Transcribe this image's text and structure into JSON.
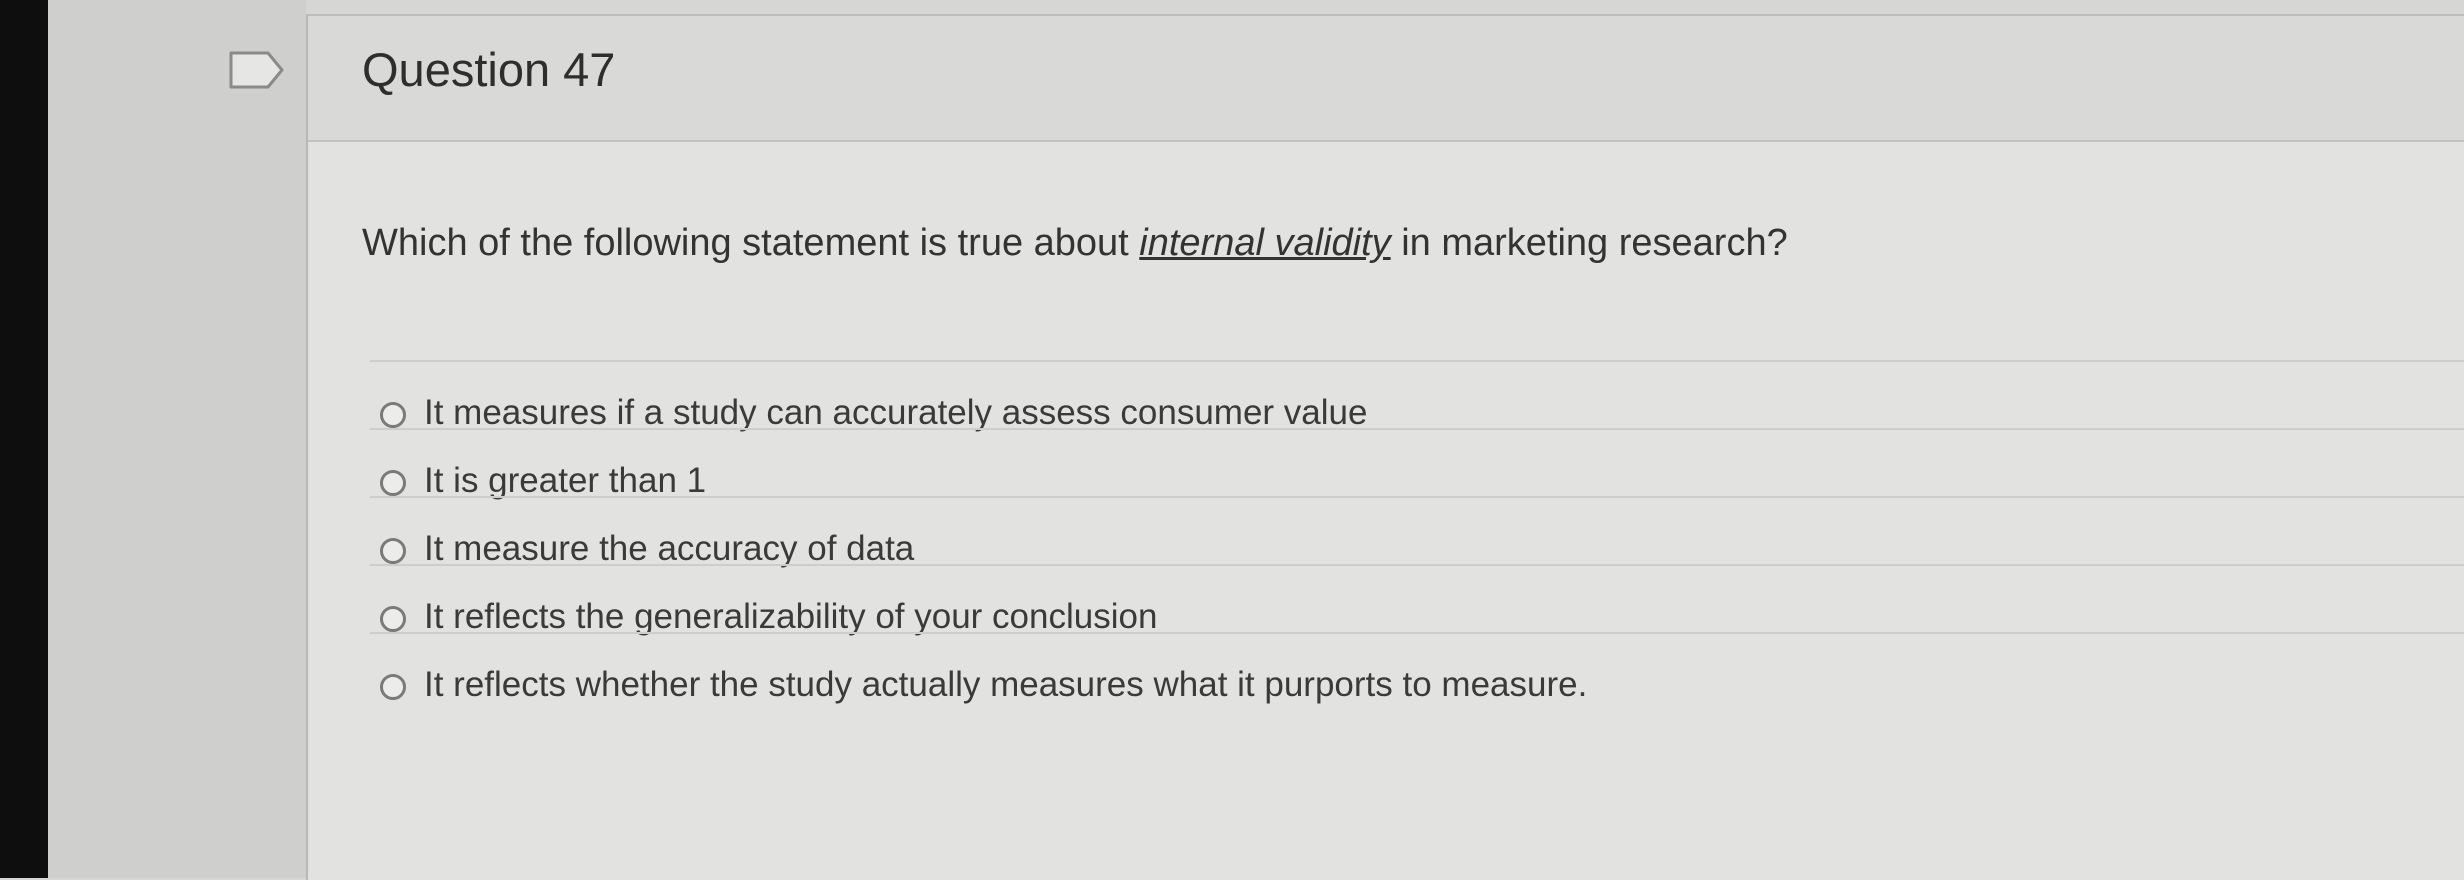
{
  "question": {
    "title": "Question 47",
    "text_before": "Which of the following statement is true about ",
    "text_emphasis": "internal validity",
    "text_after": " in marketing research?"
  },
  "options": [
    {
      "label": "It measures if a study can accurately assess consumer value",
      "selected": false
    },
    {
      "label": "It is greater than 1",
      "selected": false
    },
    {
      "label": "It measure the accuracy of data",
      "selected": false
    },
    {
      "label": "It reflects the generalizability of your conclusion",
      "selected": false
    },
    {
      "label": "It reflects whether the study actually measures what it purports to measure.",
      "selected": false
    }
  ],
  "icons": {
    "flag": "flag-icon"
  }
}
